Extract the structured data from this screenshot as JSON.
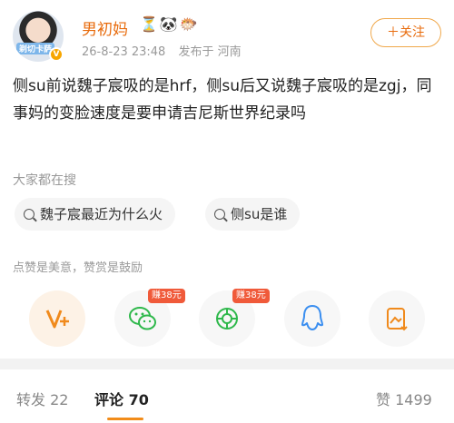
{
  "user": {
    "name": "男初妈",
    "badges": "⏳🐼🐡",
    "avatar_tag": "剃切卡萨",
    "verified_mark": "V",
    "post_time": "26-8-23 23:48",
    "location": "发布于 河南",
    "follow_label": "＋关注"
  },
  "post": {
    "text": "侧su前说魏子宸吸的是hrf，侧su后又说魏子宸吸的是zgj，同事妈的变脸速度是要申请吉尼斯世界纪录吗"
  },
  "search": {
    "title": "大家都在搜",
    "chips": [
      "魏子宸最近为什么火",
      "侧su是谁"
    ]
  },
  "reward": {
    "text": "点赞是美意，赞赏是鼓励"
  },
  "share": {
    "icons": [
      "reward-icon",
      "wechat-icon",
      "moments-icon",
      "qq-icon",
      "save-image-icon"
    ],
    "bubble1": "赚38元",
    "bubble2": "赚38元",
    "colors": {
      "orange": "#f08a1c",
      "green": "#2eb84b",
      "blue": "#3a8ef0"
    }
  },
  "tabs": {
    "repost": "转发 22",
    "comment": "评论 70",
    "like": "赞 1499"
  }
}
